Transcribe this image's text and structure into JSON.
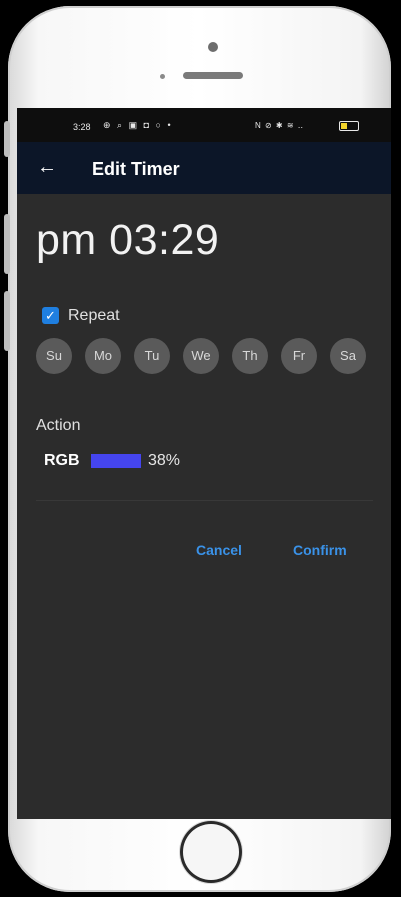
{
  "status_bar": {
    "time": "3:28",
    "left_icons": "⊕ ⌕ ▣ ◘ ○ •",
    "right_icons": "N ⊘ ✱ ≋ ‥",
    "battery_level": 0.4
  },
  "appbar": {
    "back_icon": "←",
    "title": "Edit Timer"
  },
  "timer": {
    "time_text": "pm 03:29"
  },
  "repeat": {
    "checked": true,
    "check_glyph": "✓",
    "label": "Repeat"
  },
  "days": [
    "Su",
    "Mo",
    "Tu",
    "We",
    "Th",
    "Fr",
    "Sa"
  ],
  "action": {
    "label": "Action",
    "type_label": "RGB",
    "color": "#4545ef",
    "percent": "38%"
  },
  "buttons": {
    "cancel": "Cancel",
    "confirm": "Confirm"
  },
  "colors": {
    "background": "#2c2c2c",
    "appbar": "#0c1628",
    "accent": "#3a92e8",
    "day_circle": "#5a5a5a"
  }
}
